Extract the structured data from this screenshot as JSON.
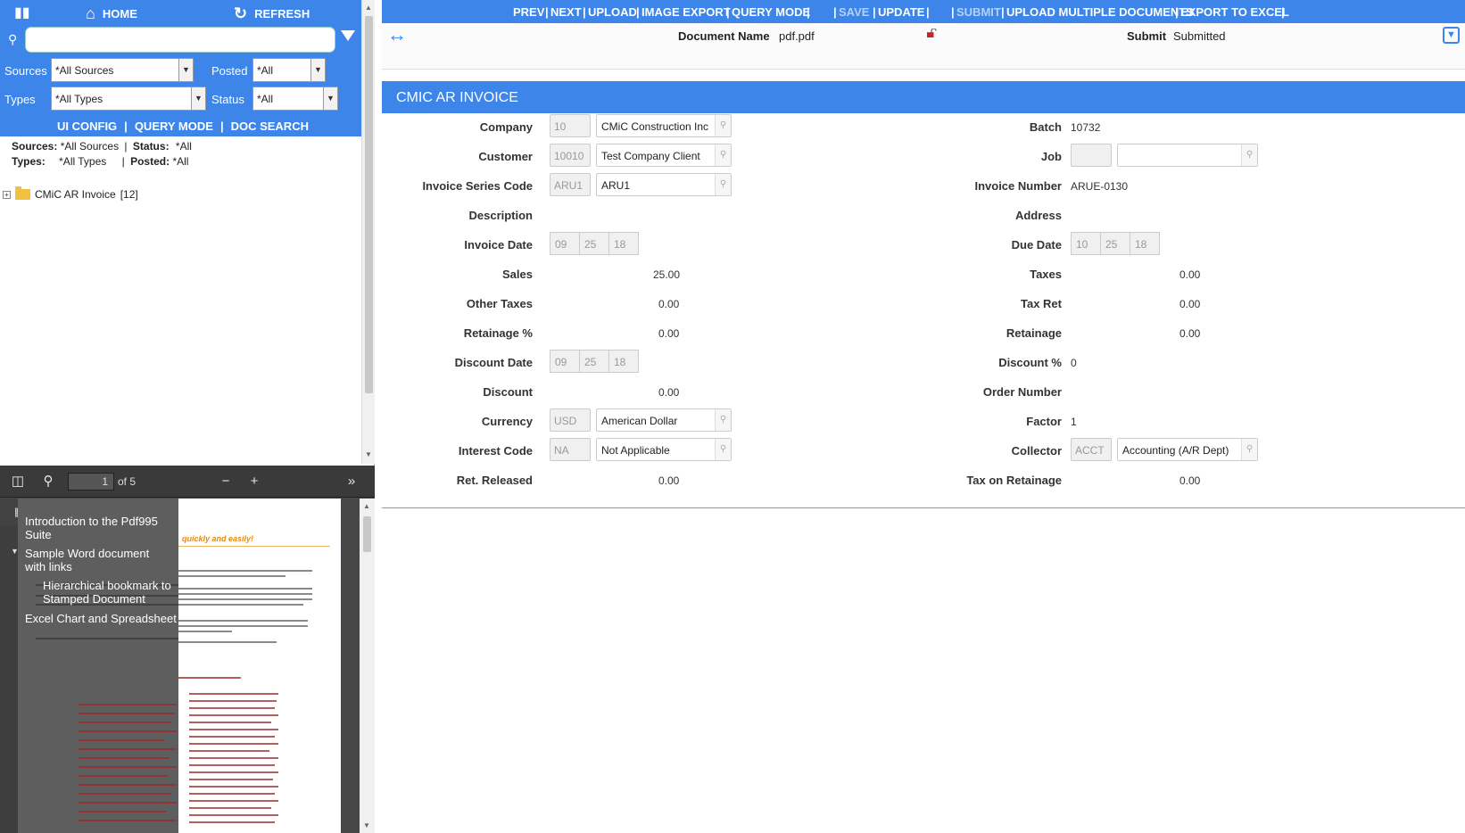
{
  "left_panel": {
    "home_label": "HOME",
    "refresh_label": "REFRESH",
    "search_placeholder": "",
    "filters": {
      "sources_label": "Sources",
      "sources_value": "*All Sources",
      "posted_label": "Posted",
      "posted_value": "*All",
      "types_label": "Types",
      "types_value": "*All Types",
      "status_label": "Status",
      "status_value": "*All"
    },
    "links": [
      "UI CONFIG",
      "QUERY MODE",
      "DOC SEARCH"
    ],
    "summary": {
      "sources_label": "Sources:",
      "sources_value": "*All Sources",
      "status_label": "Status:",
      "status_value": "*All",
      "types_label": "Types:",
      "types_value": "*All Types",
      "posted_label": "Posted:",
      "posted_value": "*All"
    },
    "tree": {
      "label": "CMiC AR Invoice",
      "count": "[12]"
    }
  },
  "pdf_viewer": {
    "page_number": "1",
    "page_total": "of 5",
    "bookmarks": [
      "Introduction to the Pdf995 Suite",
      "Sample Word document with links",
      "Hierarchical bookmark to Stamped Document",
      "Excel Chart and Spreadsheet"
    ],
    "page_heading": "quickly and easily!"
  },
  "toolbar": {
    "items": [
      "PREV",
      "NEXT",
      "UPLOAD",
      "IMAGE EXPORT",
      "QUERY MODE",
      "SAVE",
      "UPDATE",
      "SUBMIT",
      "UPLOAD MULTIPLE DOCUMENTS",
      "EXPORT TO EXCEL"
    ]
  },
  "doc_header": {
    "document_name_label": "Document Name",
    "document_name_value": "pdf.pdf",
    "submit_label": "Submit",
    "submit_value": "Submitted"
  },
  "section_title": "CMIC AR INVOICE",
  "form": {
    "company_label": "Company",
    "company_code": "10",
    "company_name": "CMiC Construction Inc",
    "customer_label": "Customer",
    "customer_code": "10010",
    "customer_name": "Test Company Client",
    "series_label": "Invoice Series Code",
    "series_code": "ARU1",
    "series_name": "ARU1",
    "description_label": "Description",
    "invoice_date_label": "Invoice Date",
    "invoice_date": [
      "09",
      "25",
      "18"
    ],
    "sales_label": "Sales",
    "sales_value": "25.00",
    "other_taxes_label": "Other Taxes",
    "other_taxes_value": "0.00",
    "retainage_pct_label": "Retainage %",
    "retainage_pct_value": "0.00",
    "discount_date_label": "Discount Date",
    "discount_date": [
      "09",
      "25",
      "18"
    ],
    "discount_label": "Discount",
    "discount_value": "0.00",
    "currency_label": "Currency",
    "currency_code": "USD",
    "currency_name": "American Dollar",
    "interest_label": "Interest Code",
    "interest_code": "NA",
    "interest_name": "Not Applicable",
    "ret_released_label": "Ret. Released",
    "ret_released_value": "0.00",
    "batch_label": "Batch",
    "batch_value": "10732",
    "job_label": "Job",
    "invoice_number_label": "Invoice Number",
    "invoice_number_value": "ARUE-0130",
    "address_label": "Address",
    "due_date_label": "Due Date",
    "due_date": [
      "10",
      "25",
      "18"
    ],
    "taxes_label": "Taxes",
    "taxes_value": "0.00",
    "tax_ret_label": "Tax Ret",
    "tax_ret_value": "0.00",
    "retainage_label": "Retainage",
    "retainage_value": "0.00",
    "discount_pct_label": "Discount %",
    "discount_pct_value": "0",
    "order_number_label": "Order Number",
    "factor_label": "Factor",
    "factor_value": "1",
    "collector_label": "Collector",
    "collector_code": "ACCT",
    "collector_name": "Accounting (A/R Dept)",
    "tax_on_ret_label": "Tax on Retainage",
    "tax_on_ret_value": "0.00"
  },
  "colors": {
    "accent": "#3d85e8",
    "disabled_text": "#b8d0f4"
  }
}
